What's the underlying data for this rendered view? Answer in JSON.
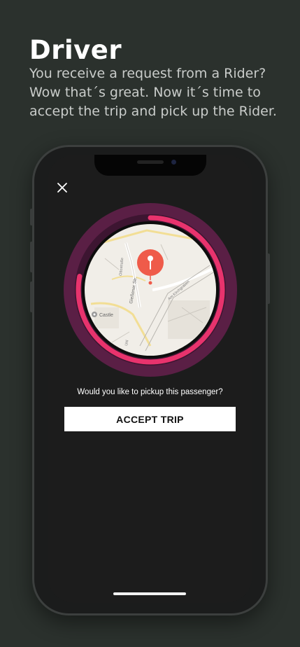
{
  "header": {
    "title": "Driver",
    "subtitle": "You receive a request from a Rider? Wow that´s great. Now it´s time to accept the trip and pick up the Rider."
  },
  "screen": {
    "close_icon": "close-icon",
    "map": {
      "labels": {
        "street_1": "Gießener Str.",
        "street_2": "Ottostraße",
        "street_3": "Am Kirchgraben",
        "street_4": "Uhl",
        "poi": "Castle"
      },
      "pin_icon": "map-pin-icon",
      "countdown_progress": 0.78
    },
    "prompt": "Would you like to pickup this passenger?",
    "accept_button": "ACCEPT TRIP"
  },
  "colors": {
    "background": "#2b312d",
    "ring_outer": "#5a1f45",
    "ring_track": "#3d1531",
    "progress": "#e8336d",
    "pin": "#ef5b4a",
    "button_bg": "#ffffff"
  }
}
